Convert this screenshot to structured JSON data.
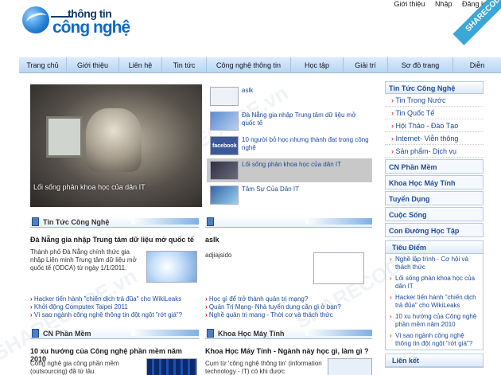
{
  "header": {
    "logo_top": "thông tin",
    "logo_main": "công nghệ",
    "top_links": [
      "Giới thiệu",
      "Nhập",
      "Đăng ký"
    ],
    "ribbon": "SHARECODE.vn"
  },
  "nav": {
    "items": [
      "Trang chủ",
      "Giới thiệu",
      "Liên hệ",
      "Tin tức",
      "Công nghệ thông tin",
      "Học tập",
      "Giải trí",
      "Sơ đồ trang",
      "Diễn"
    ]
  },
  "featured": {
    "caption": "Lối sống phản khoa học của dân IT",
    "items": [
      {
        "title": "aslk"
      },
      {
        "title": "Đà Nẵng gia nhập Trung tâm dữ liệu mở quốc tế"
      },
      {
        "title": "10 người bỏ học nhưng thành đạt trong công nghệ"
      },
      {
        "title": "Lối sống phản khoa học của dân IT"
      },
      {
        "title": "Tâm Sự Của Dân IT"
      }
    ],
    "fb_label": "facebook"
  },
  "box_news": {
    "header": "Tin Tức Công Nghệ",
    "title": "Đà Nẵng gia nhập Trung tâm dữ liệu mở quốc tế",
    "body": "Thành phố Đà Nẵng chính thức gia nhập Liên minh Trung tâm dữ liệu mở quốc tế (ODCA) từ ngày 1/1/2011.",
    "links": [
      "Hacker tiến hành \"chiến dịch trả đũa\" cho WikiLeaks",
      "Khởi động Computex Taipei 2011",
      "Vì sao ngành công nghệ thông tin đột ngột \"rớt giá\"?"
    ]
  },
  "box_aslk": {
    "header": "aslk",
    "title": "adjiajsido",
    "links": [
      "Học gì để trở thành quản trị mạng?",
      "Quản Trị Mạng- Nhà tuyển dụng cần gì ở bạn?",
      "Nghề quản trị mạng - Thời cơ và thách thức"
    ]
  },
  "box_software": {
    "header": "CN Phần Mềm",
    "title": "10 xu hướng của Công nghệ phần mềm năm 2010",
    "body": "Công nghệ gia công phần mềm (outsourcing) đã từ lâu"
  },
  "box_cs": {
    "header": "Khoa Học Máy Tính",
    "title": "Khoa Học Máy Tính - Ngành này học gì, làm gì ?",
    "body": "Cụm từ 'công nghệ thông tin' (information technology - IT) có khi được"
  },
  "sidebar": {
    "head": "Tin Tức Công Nghệ",
    "subs": [
      "Tin Trong Nước",
      "Tin Quốc Tế",
      "Hội Thảo - Đào Tạo",
      "Internet- Viễn thông",
      "Sản phẩm- Dịch vụ"
    ],
    "cats": [
      "CN Phần Mềm",
      "Khoa Học Máy Tính",
      "Tuyển Dụng",
      "Cuộc Sống",
      "Con Đường Học Tập"
    ],
    "focus_head": "Tiêu Điểm",
    "focus_links": [
      "Nghề lập trình - Cơ hội và thách thức",
      "Lối sống phản khoa học của dân IT",
      "Hacker tiến hành \"chiến dịch trả đũa\" cho WikiLeaks",
      "10 xu hướng của Công nghệ phần mềm năm 2010",
      "Vì sao ngành công nghệ thông tin đột ngột \"rớt giá\"?"
    ],
    "links_head": "Liên kết"
  },
  "watermark": "SHARECODE.vn"
}
